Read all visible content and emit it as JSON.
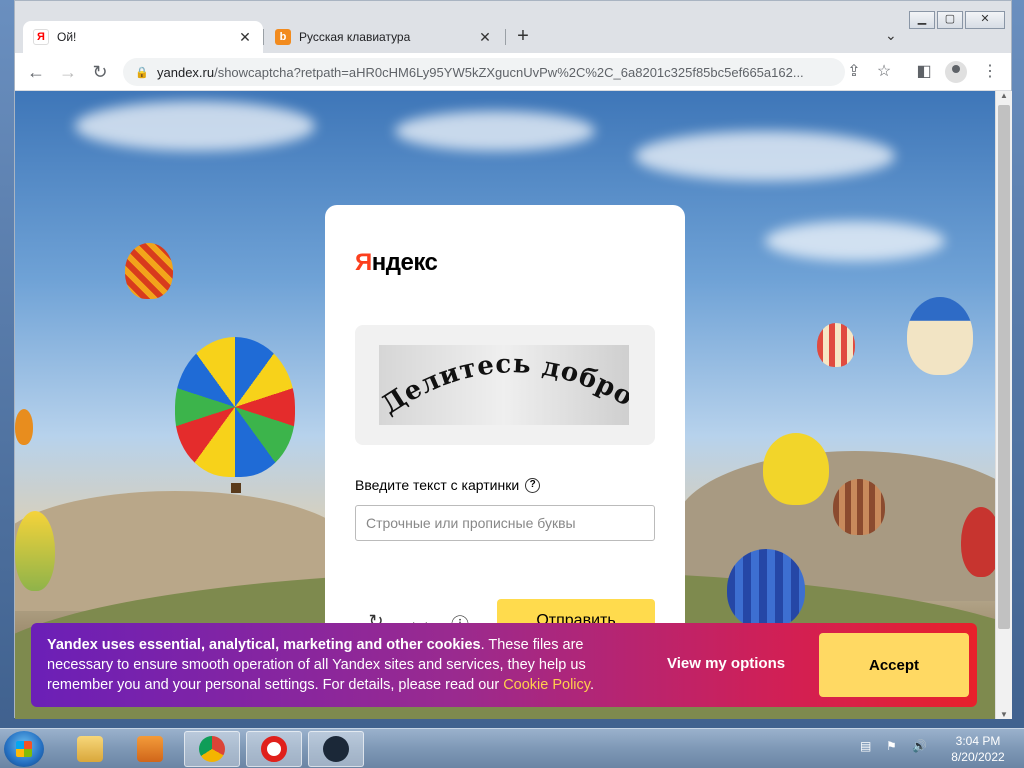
{
  "browser": {
    "tabs": [
      {
        "title": "Ой!",
        "favicon": "yandex-icon",
        "active": true
      },
      {
        "title": "Русская клавиатура",
        "favicon": "bee-icon",
        "active": false
      }
    ],
    "url_host": "yandex.ru",
    "url_path": "/showcaptcha?retpath=aHR0cHM6Ly95YW5kZXgucnUvPw%2C%2C_6a8201c325f85bc5ef665a162..."
  },
  "captcha": {
    "logo": "Яндекс",
    "logo_first": "Я",
    "logo_rest": "ндекс",
    "captcha_text": "Делитесь добром",
    "label": "Введите текст с картинки",
    "input_value": "",
    "input_placeholder": "Строчные или прописные буквы",
    "submit_label": "Отправить"
  },
  "cookie_banner": {
    "bold_text": "Yandex uses essential, analytical, marketing and other cookies",
    "text": ". These files are necessary to ensure smooth operation of all Yandex sites and services, they help us remember you and your personal settings. For details, please read our ",
    "link_text": "Cookie Policy",
    "end_text": ".",
    "view_options_label": "View my options",
    "accept_label": "Accept"
  },
  "taskbar": {
    "apps": [
      "file-explorer-icon",
      "media-player-icon",
      "chrome-icon",
      "opera-icon",
      "steam-icon"
    ],
    "time": "3:04 PM",
    "date": "8/20/2022"
  },
  "colors": {
    "yandex_red": "#fc3f1d",
    "submit_yellow": "#ffdb4d",
    "accept_yellow": "#ffd963",
    "cookie_link": "#ffcf4d"
  }
}
